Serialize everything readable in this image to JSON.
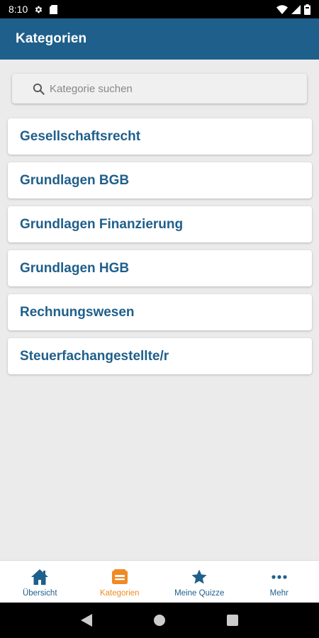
{
  "status_bar": {
    "time": "8:10",
    "icons": [
      "settings-gear-icon",
      "sd-card-icon",
      "wifi-icon",
      "cell-signal-icon",
      "battery-icon"
    ]
  },
  "app_bar": {
    "title": "Kategorien",
    "color": "#1f5f8b"
  },
  "search": {
    "placeholder": "Kategorie suchen",
    "value": ""
  },
  "categories": [
    {
      "label": "Gesellschaftsrecht"
    },
    {
      "label": "Grundlagen BGB"
    },
    {
      "label": "Grundlagen Finanzierung"
    },
    {
      "label": "Grundlagen HGB"
    },
    {
      "label": "Rechnungswesen"
    },
    {
      "label": "Steuerfachangestellte/r"
    }
  ],
  "bottom_nav": {
    "items": [
      {
        "label": "Übersicht",
        "icon": "home-icon",
        "active": false
      },
      {
        "label": "Kategorien",
        "icon": "category-box-icon",
        "active": true
      },
      {
        "label": "Meine Quizze",
        "icon": "star-icon",
        "active": false
      },
      {
        "label": "Mehr",
        "icon": "more-dots-icon",
        "active": false
      }
    ],
    "accent_color": "#f08a24",
    "primary_color": "#1f5f8b"
  },
  "system_nav": {
    "icons": [
      "back-icon",
      "home-circle-icon",
      "recents-square-icon"
    ]
  }
}
